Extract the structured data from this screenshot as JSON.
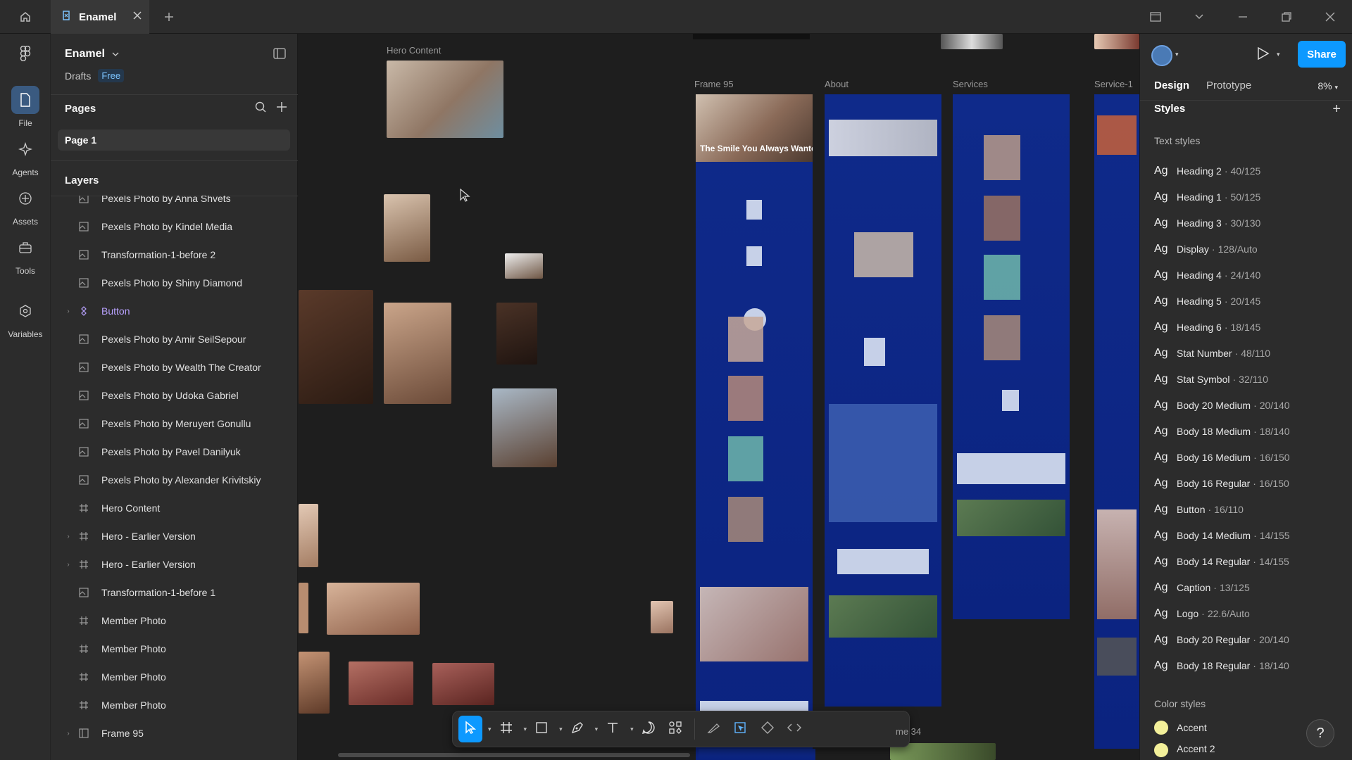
{
  "tabs": {
    "file_name": "Enamel"
  },
  "rail": {
    "items": [
      {
        "label": "File",
        "icon": "file-icon"
      },
      {
        "label": "Agents",
        "icon": "agents-icon"
      },
      {
        "label": "Assets",
        "icon": "assets-icon"
      },
      {
        "label": "Tools",
        "icon": "tools-icon"
      },
      {
        "label": "Variables",
        "icon": "variables-icon"
      }
    ]
  },
  "left_panel": {
    "project_name": "Enamel",
    "location": "Drafts",
    "plan_badge": "Free",
    "pages_title": "Pages",
    "pages": [
      "Page 1"
    ],
    "layers_title": "Layers",
    "layers": [
      {
        "label": "Pexels Photo by Anna Shvets",
        "type": "image",
        "expandable": false
      },
      {
        "label": "Pexels Photo by Kindel Media",
        "type": "image",
        "expandable": false
      },
      {
        "label": "Transformation-1-before 2",
        "type": "image",
        "expandable": false
      },
      {
        "label": "Pexels Photo by Shiny Diamond",
        "type": "image",
        "expandable": false
      },
      {
        "label": "Button",
        "type": "component",
        "expandable": true
      },
      {
        "label": "Pexels Photo by Amir SeilSepour",
        "type": "image",
        "expandable": false
      },
      {
        "label": "Pexels Photo by Wealth The Creator",
        "type": "image",
        "expandable": false
      },
      {
        "label": "Pexels Photo by Udoka Gabriel",
        "type": "image",
        "expandable": false
      },
      {
        "label": "Pexels Photo by Meruyert Gonullu",
        "type": "image",
        "expandable": false
      },
      {
        "label": "Pexels Photo by Pavel Danilyuk",
        "type": "image",
        "expandable": false
      },
      {
        "label": "Pexels Photo by Alexander Krivitskiy",
        "type": "image",
        "expandable": false
      },
      {
        "label": "Hero Content",
        "type": "frame",
        "expandable": false
      },
      {
        "label": "Hero - Earlier Version",
        "type": "frame",
        "expandable": true
      },
      {
        "label": "Hero - Earlier Version",
        "type": "frame",
        "expandable": true
      },
      {
        "label": "Transformation-1-before 1",
        "type": "image",
        "expandable": false
      },
      {
        "label": "Member Photo",
        "type": "frame",
        "expandable": false
      },
      {
        "label": "Member Photo",
        "type": "frame",
        "expandable": false
      },
      {
        "label": "Member Photo",
        "type": "frame",
        "expandable": false
      },
      {
        "label": "Member Photo",
        "type": "frame",
        "expandable": false
      },
      {
        "label": "Frame 95",
        "type": "section",
        "expandable": true
      }
    ]
  },
  "canvas": {
    "labels": {
      "hero_content": "Hero Content",
      "frame95": "Frame 95",
      "about": "About",
      "services": "Services",
      "service1": "Service-1",
      "frame34": "me 34"
    },
    "hero_heading": "The Smile You Always Wante"
  },
  "toolbar": {
    "tools": [
      "move-tool",
      "frame-tool",
      "shape-tool",
      "pen-tool",
      "text-tool",
      "comment-tool",
      "actions-tool"
    ],
    "modes": [
      "draw-mode",
      "design-mode",
      "dev-component-mode",
      "dev-mode"
    ]
  },
  "right_panel": {
    "share_label": "Share",
    "tabs": {
      "design": "Design",
      "prototype": "Prototype"
    },
    "zoom": "8%",
    "styles_title": "Styles",
    "text_styles_title": "Text styles",
    "ag": "Ag",
    "text_styles": [
      {
        "name": "Heading 2",
        "meta": "40/125"
      },
      {
        "name": "Heading 1",
        "meta": "50/125"
      },
      {
        "name": "Heading 3",
        "meta": "30/130"
      },
      {
        "name": "Display",
        "meta": "128/Auto"
      },
      {
        "name": "Heading 4",
        "meta": "24/140"
      },
      {
        "name": "Heading 5",
        "meta": "20/145"
      },
      {
        "name": "Heading 6",
        "meta": "18/145"
      },
      {
        "name": "Stat Number",
        "meta": "48/110"
      },
      {
        "name": "Stat Symbol",
        "meta": "32/110"
      },
      {
        "name": "Body 20 Medium",
        "meta": "20/140"
      },
      {
        "name": "Body 18 Medium",
        "meta": "18/140"
      },
      {
        "name": "Body 16 Medium",
        "meta": "16/150"
      },
      {
        "name": "Body 16 Regular",
        "meta": "16/150"
      },
      {
        "name": "Button",
        "meta": "16/110"
      },
      {
        "name": "Body 14 Medium",
        "meta": "14/155"
      },
      {
        "name": "Body 14 Regular",
        "meta": "14/155"
      },
      {
        "name": "Caption",
        "meta": "13/125"
      },
      {
        "name": "Logo",
        "meta": "22.6/Auto"
      },
      {
        "name": "Body 20 Regular",
        "meta": "20/140"
      },
      {
        "name": "Body 18 Regular",
        "meta": "18/140"
      }
    ],
    "color_styles_title": "Color styles",
    "color_styles": [
      {
        "name": "Accent",
        "color": "#f3f09a"
      },
      {
        "name": "Accent 2",
        "color": "#f3f09a"
      }
    ],
    "help_label": "?"
  },
  "colors": {
    "accent": "#0d99ff",
    "frame_blue": "#0f2a8a",
    "component": "#b9a2ff"
  }
}
